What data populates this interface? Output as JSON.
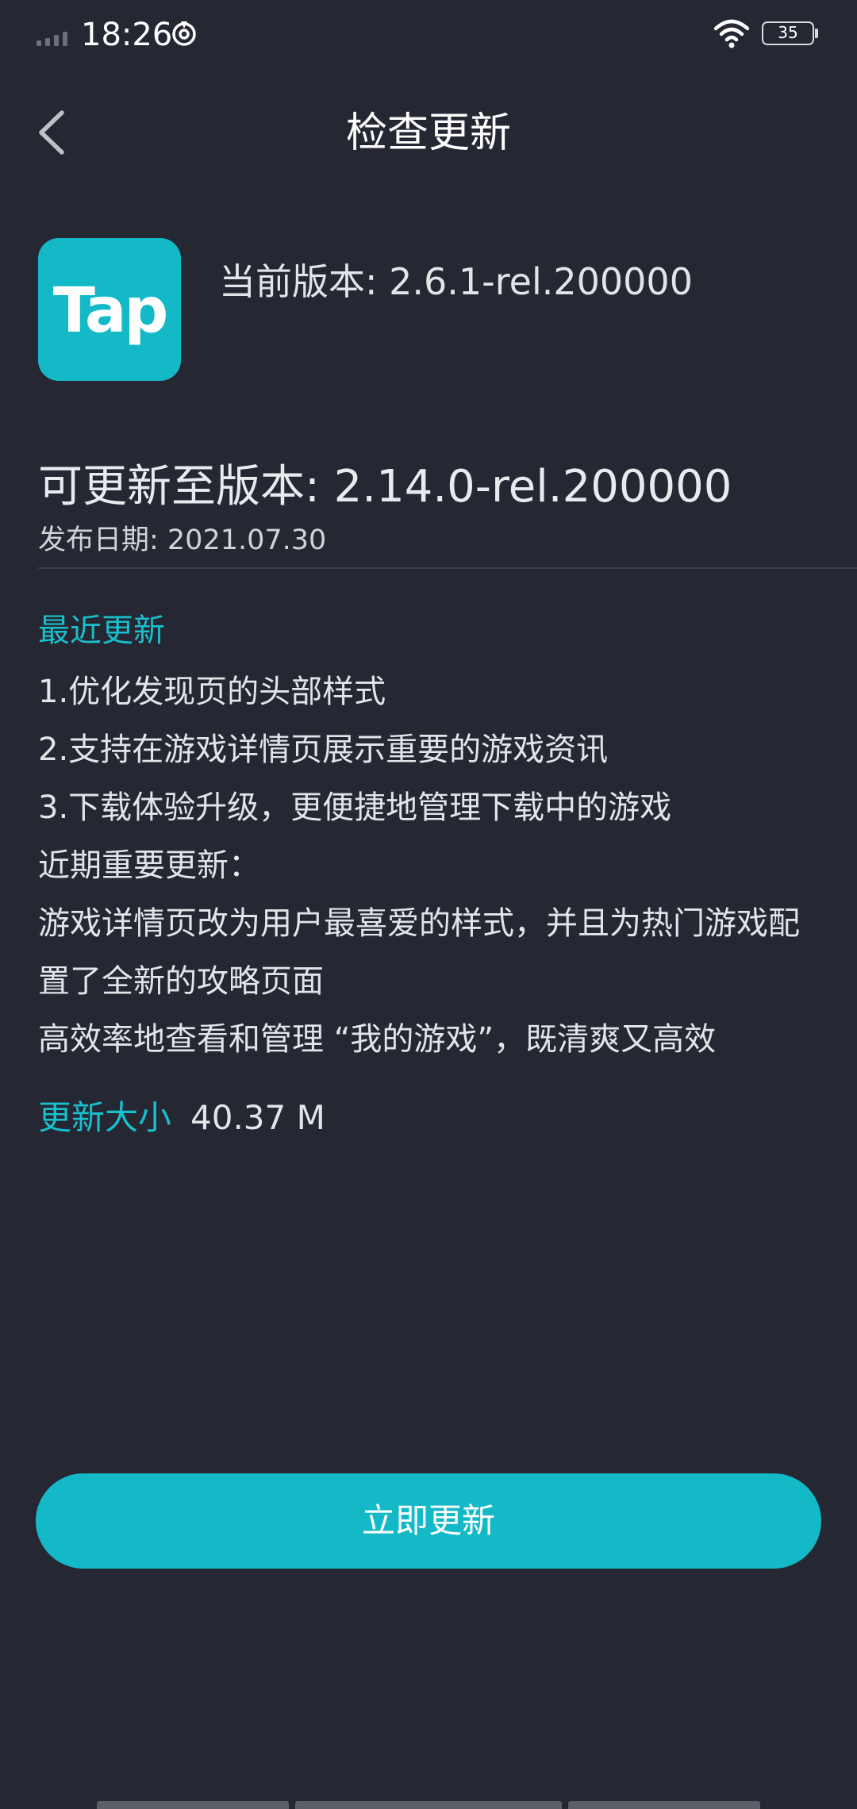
{
  "status_bar": {
    "time": "18:26",
    "battery": "35"
  },
  "header": {
    "title": "检查更新"
  },
  "app": {
    "logo_text": "Tap",
    "current_version": "当前版本: 2.6.1-rel.200000"
  },
  "update": {
    "target_version": "可更新至版本: 2.14.0-rel.200000",
    "release_date": "发布日期: 2021.07.30",
    "recent_heading": "最近更新",
    "notes": [
      "1.优化发现页的头部样式",
      "2.支持在游戏详情页展示重要的游戏资讯",
      "3.下载体验升级，更便捷地管理下载中的游戏",
      "近期重要更新：",
      "游戏详情页改为用户最喜爱的样式，并且为热门游戏配",
      "置了全新的攻略页面",
      "高效率地查看和管理 “我的游戏”，既清爽又高效"
    ],
    "size_label": "更新大小",
    "size_value": "40.37 M"
  },
  "actions": {
    "update_now": "立即更新"
  },
  "colors": {
    "background": "#252732",
    "accent": "#14b9c8",
    "accent_text": "#19bfcd"
  }
}
